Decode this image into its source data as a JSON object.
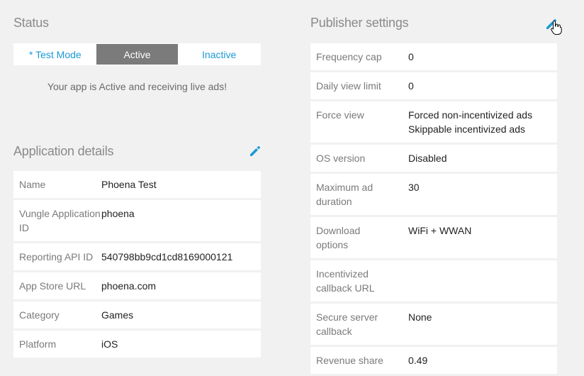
{
  "status": {
    "title": "Status",
    "modes": [
      "* Test Mode",
      "Active",
      "Inactive"
    ],
    "active_index": 1,
    "message": "Your app is Active and receiving live ads!"
  },
  "app_details": {
    "title": "Application details",
    "rows": [
      {
        "label": "Name",
        "value": "Phoena Test"
      },
      {
        "label": "Vungle Application ID",
        "value": "phoena"
      },
      {
        "label": "Reporting API ID",
        "value": "540798bb9cd1cd8169000121"
      },
      {
        "label": "App Store URL",
        "value": "phoena.com"
      },
      {
        "label": "Category",
        "value": "Games"
      },
      {
        "label": "Platform",
        "value": "iOS"
      }
    ]
  },
  "publisher": {
    "title": "Publisher settings",
    "rows": [
      {
        "label": "Frequency cap",
        "value": "0"
      },
      {
        "label": "Daily view limit",
        "value": "0"
      },
      {
        "label": "Force view",
        "value": "Forced non-incentivized ads",
        "value2": "Skippable incentivized ads"
      },
      {
        "label": "OS version",
        "value": "Disabled"
      },
      {
        "label": "Maximum ad duration",
        "value": "30"
      },
      {
        "label": "Download options",
        "value": "WiFi + WWAN"
      },
      {
        "label": "Incentivized callback URL",
        "value": ""
      },
      {
        "label": "Secure server callback",
        "value": "None"
      },
      {
        "label": "Revenue share",
        "value": "0.49"
      }
    ]
  },
  "colors": {
    "accent": "#1a9ad6",
    "active_segment": "#7b7b7b",
    "background": "#f1f1f1"
  },
  "icons": {
    "edit": "pencil-icon",
    "cursor": "hand-pointer-icon"
  }
}
